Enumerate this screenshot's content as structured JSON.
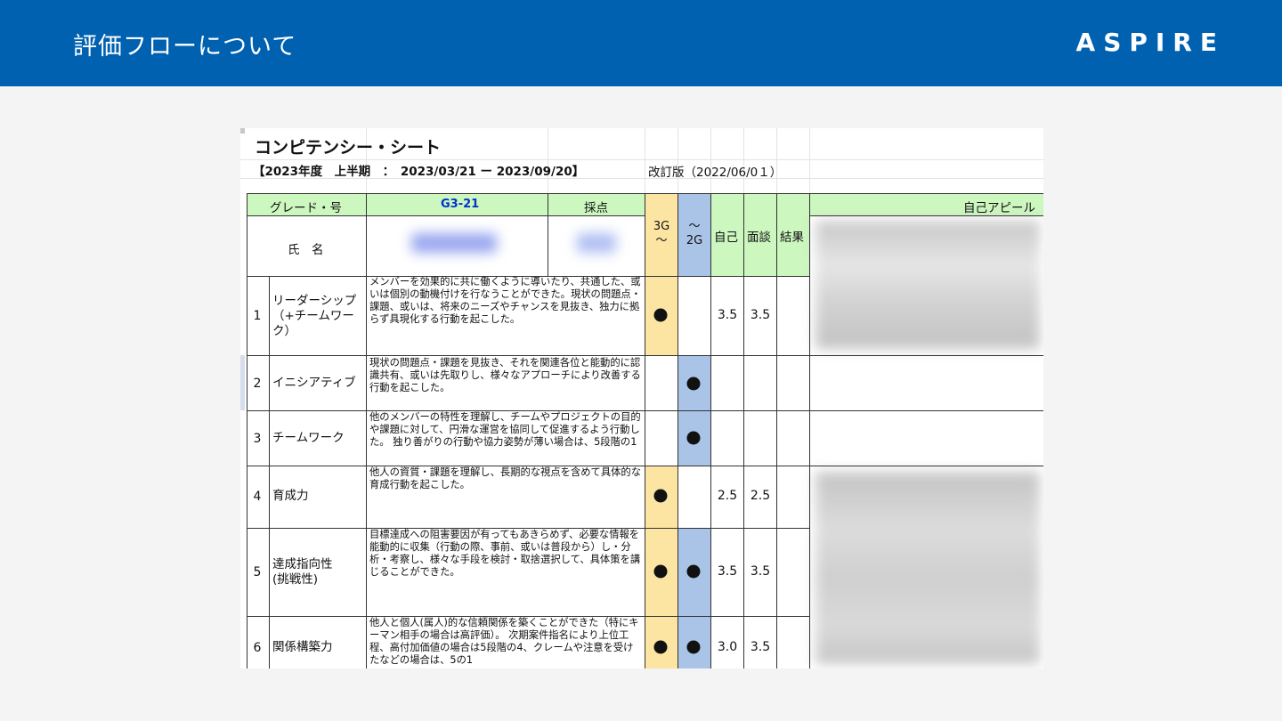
{
  "header": {
    "title": "評価フローについて",
    "logo": "ASPIRE",
    "background_color": "#0061b0"
  },
  "sheet": {
    "title": "コンピテンシー・シート",
    "period": "【2023年度　上半期　：　2023/03/21 ー 2023/09/20】",
    "revised": "改訂版（2022/06/0１）",
    "header_row": {
      "grade_label": "グレード・号",
      "grade_value": "G3-21",
      "score_label": "採点",
      "col_3g": "3G\n〜",
      "col_2g": "〜\n2G",
      "self_label": "自己",
      "interview_label": "面談",
      "result_label": "結果",
      "appeal_label": "自己アピール"
    },
    "name_label": "氏　名",
    "rows": [
      {
        "no": "1",
        "name": "リーダーシップ（+チームワーク）",
        "description": "メンバーを効果的に共に働くように導いたり、共通した、或いは個別の動機付けを行なうことができた。現状の問題点・課題、或いは、将来のニーズやチャンスを見抜き、独力に拠らず具現化する行動を起こした。",
        "mark_3g": true,
        "mark_2g": false,
        "self": "3.5",
        "interview": "3.5"
      },
      {
        "no": "2",
        "name": "イニシアティブ",
        "description": "現状の問題点・課題を見抜き、それを関連各位と能動的に認識共有、或いは先取りし、様々なアプローチにより改善する行動を起こした。",
        "mark_3g": false,
        "mark_2g": true,
        "self": "",
        "interview": ""
      },
      {
        "no": "3",
        "name": "チームワーク",
        "description": "他のメンバーの特性を理解し、チームやプロジェクトの目的や課題に対して、円滑な運営を協同して促進するよう行動した。 独り善がりの行動や協力姿勢が薄い場合は、5段階の1",
        "mark_3g": false,
        "mark_2g": true,
        "self": "",
        "interview": ""
      },
      {
        "no": "4",
        "name": "育成力",
        "description": "他人の資質・課題を理解し、長期的な視点を含めて具体的な育成行動を起こした。",
        "mark_3g": true,
        "mark_2g": false,
        "self": "2.5",
        "interview": "2.5"
      },
      {
        "no": "5",
        "name": "達成指向性(挑戦性)",
        "description": "目標達成への阻害要因が有ってもあきらめず、必要な情報を能動的に収集（行動の際、事前、或いは普段から）し・分析・考察し、様々な手段を検討・取捨選択して、具体策を講じることができた。",
        "mark_3g": true,
        "mark_2g": true,
        "self": "3.5",
        "interview": "3.5"
      },
      {
        "no": "6",
        "name": "関係構築力",
        "description": "他人と個人(属人)的な信頼関係を築くことができた（特にキーマン相手の場合は高評価）。 次期案件指名により上位工程、高付加価値の場合は5段階の4、クレームや注意を受けたなどの場合は、5の1",
        "mark_3g": true,
        "mark_2g": true,
        "self": "3.0",
        "interview": "3.5"
      }
    ],
    "colors": {
      "green": "#ccf7bf",
      "yellow": "#fce5a3",
      "blue": "#a9c4e6",
      "grade_text": "#0033cc"
    }
  }
}
